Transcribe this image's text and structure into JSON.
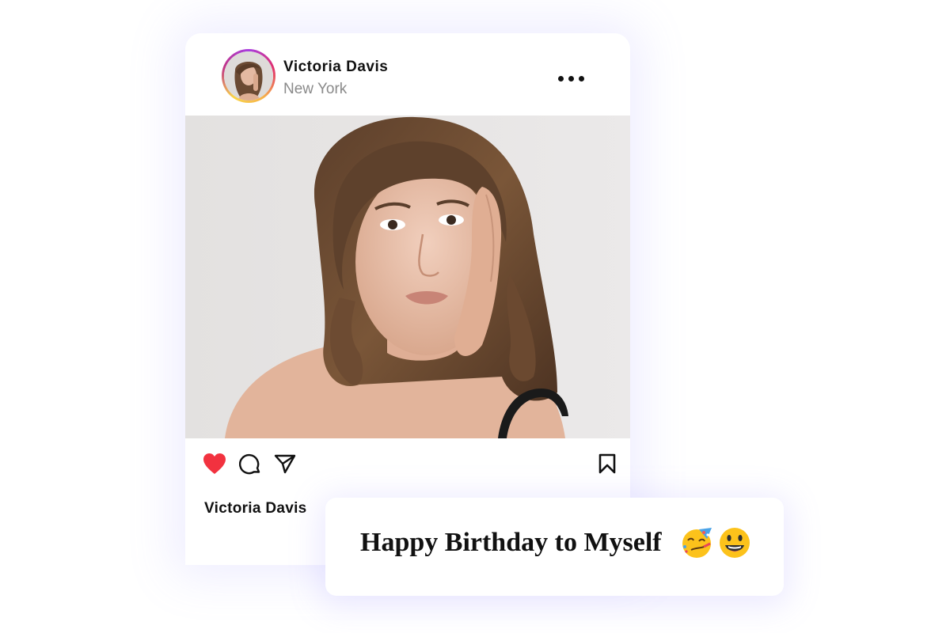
{
  "post": {
    "username": "Victoria Davis",
    "location": "New York",
    "caption_username": "Victoria Davis",
    "liked": true,
    "like_color": "#f2323f"
  },
  "icons": {
    "more": "more-options-icon",
    "like": "heart-icon",
    "comment": "comment-icon",
    "share": "send-icon",
    "save": "bookmark-icon"
  },
  "message": {
    "text": "Happy Birthday to Myself",
    "emojis": [
      "partying-face-emoji",
      "grinning-face-emoji"
    ]
  }
}
